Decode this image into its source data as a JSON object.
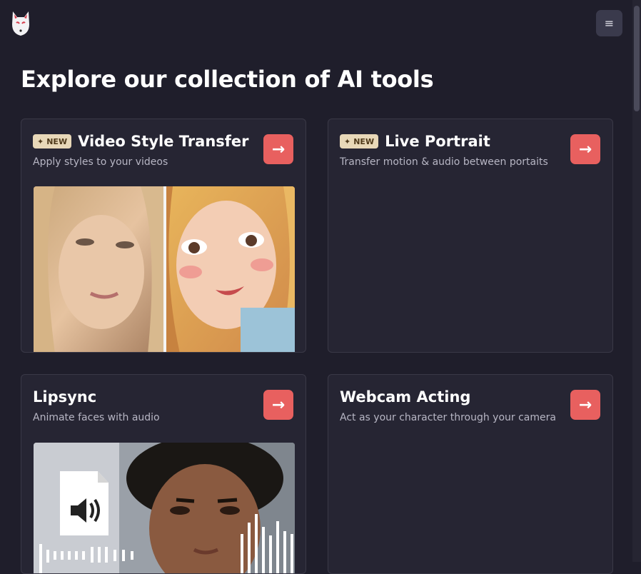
{
  "header": {
    "logo_icon": "fox-mask-icon",
    "menu_icon": "hamburger-icon",
    "menu_glyph": "≡"
  },
  "page": {
    "title": "Explore our collection of AI tools"
  },
  "cards": [
    {
      "badge": "NEW",
      "title": "Video Style Transfer",
      "subtitle": "Apply styles to your videos",
      "arrow": "→"
    },
    {
      "badge": "NEW",
      "title": "Live Portrait",
      "subtitle": "Transfer motion & audio between portaits",
      "arrow": "→"
    },
    {
      "title": "Lipsync",
      "subtitle": "Animate faces with audio",
      "arrow": "→"
    },
    {
      "title": "Webcam Acting",
      "subtitle": "Act as your character through your camera",
      "arrow": "→"
    }
  ],
  "colors": {
    "background": "#1f1e2b",
    "card": "#262533",
    "accent": "#e8605f",
    "badge_bg": "#e8d8b8"
  }
}
